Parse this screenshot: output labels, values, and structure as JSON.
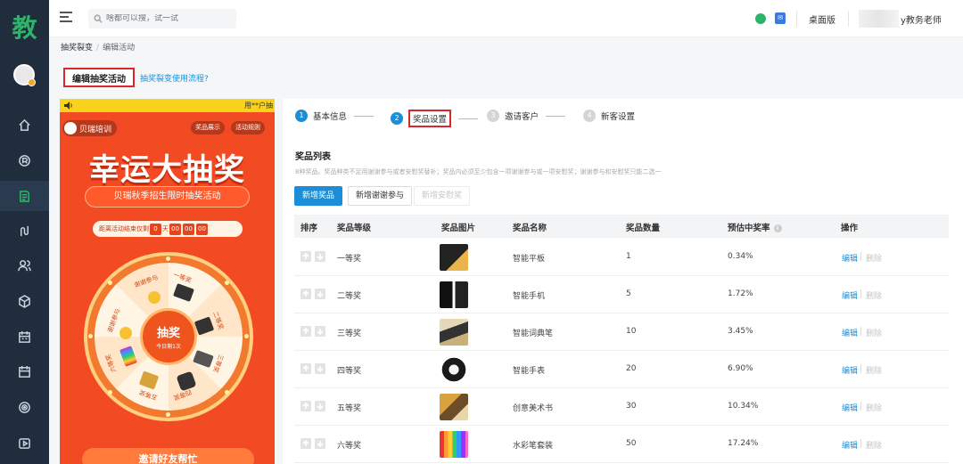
{
  "sidebar": {
    "logo": "教",
    "icons": [
      "home-icon",
      "record-icon",
      "document-icon",
      "route-icon",
      "users-icon",
      "cube-icon",
      "calendar-icon",
      "calendar-check-icon",
      "target-icon",
      "video-icon"
    ],
    "active_index": 2
  },
  "topbar": {
    "search_placeholder": "啥都可以搜，试一试",
    "desktop_label": "桌面版",
    "user_name": "y教务老师"
  },
  "breadcrumb": {
    "parent": "抽奖裂变",
    "separator": "/",
    "current": "编辑活动"
  },
  "page": {
    "title": "编辑抽奖活动",
    "help_link": "抽奖裂变使用流程?"
  },
  "phone": {
    "status_hint": "用**户抽",
    "brand": "贝瑞培训",
    "pill_prizes": "奖品展示",
    "pill_rules": "活动规则",
    "headline": "幸运大抽奖",
    "subtitle": "贝瑞秋季招生限时抽奖活动",
    "countdown_label": "距离活动结束仅剩",
    "countdown_days": "0",
    "countdown_day_unit": "天",
    "countdown_h": "00",
    "countdown_m": "00",
    "countdown_s": "00",
    "wheel_center": "抽奖",
    "wheel_sub": "今日剩1次",
    "wheel_labels": [
      "一等奖",
      "二等奖",
      "三等奖",
      "四等奖",
      "五等奖",
      "六等奖",
      "谢谢参与",
      "谢谢参与"
    ],
    "invite_button": "邀请好友帮忙"
  },
  "steps": [
    {
      "num": "1",
      "label": "基本信息",
      "state": "done"
    },
    {
      "num": "2",
      "label": "奖品设置",
      "state": "active"
    },
    {
      "num": "3",
      "label": "邀请客户",
      "state": "todo"
    },
    {
      "num": "4",
      "label": "新客设置",
      "state": "todo"
    }
  ],
  "prize_section": {
    "title": "奖品列表",
    "note": "8种奖品。奖品种类不足用谢谢参与或者安慰奖替补；奖品内必须至少包含一项谢谢参与或一项安慰奖；谢谢参与和安慰奖只能二选一",
    "btn_add_prize": "新增奖品",
    "btn_add_thanks": "新增谢谢参与",
    "btn_add_consolation": "新增安慰奖"
  },
  "table": {
    "headers": [
      "排序",
      "奖品等级",
      "奖品图片",
      "奖品名称",
      "奖品数量",
      "预估中奖率",
      "操作"
    ],
    "op_edit": "编辑",
    "op_delete": "删除",
    "rows": [
      {
        "level": "一等奖",
        "name": "智能平板",
        "qty": "1",
        "rate": "0.34%"
      },
      {
        "level": "二等奖",
        "name": "智能手机",
        "qty": "5",
        "rate": "1.72%"
      },
      {
        "level": "三等奖",
        "name": "智能词典笔",
        "qty": "10",
        "rate": "3.45%"
      },
      {
        "level": "四等奖",
        "name": "智能手表",
        "qty": "20",
        "rate": "6.90%"
      },
      {
        "level": "五等奖",
        "name": "创意美术书",
        "qty": "30",
        "rate": "10.34%"
      },
      {
        "level": "六等奖",
        "name": "水彩笔套装",
        "qty": "50",
        "rate": "17.24%"
      }
    ]
  },
  "colors": {
    "sidebar_bg": "#1f2d3d",
    "accent_green": "#2fb36b",
    "primary_blue": "#1a8fd8",
    "highlight_red": "#d9262c",
    "phone_orange": "#f24b23"
  }
}
